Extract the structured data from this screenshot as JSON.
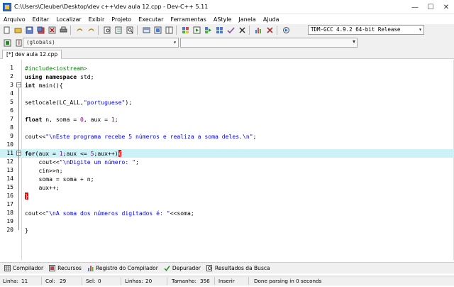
{
  "window": {
    "title": "C:\\Users\\Cleuber\\Desktop\\dev c++\\dev aula 12.cpp - Dev-C++ 5.11",
    "controls": {
      "minimize": "—",
      "maximize": "☐",
      "close": "✕"
    }
  },
  "menu": {
    "items": [
      {
        "label": "Arquivo"
      },
      {
        "label": "Editar"
      },
      {
        "label": "Localizar"
      },
      {
        "label": "Exibir"
      },
      {
        "label": "Projeto"
      },
      {
        "label": "Executar"
      },
      {
        "label": "Ferramentas"
      },
      {
        "label": "AStyle"
      },
      {
        "label": "Janela"
      },
      {
        "label": "Ajuda"
      }
    ]
  },
  "toolbar": {
    "compiler": "TDM-GCC 4.9.2 64-bit Release",
    "scope": "(globals)",
    "function": ""
  },
  "tabs": [
    {
      "label": "[*] dev aula 12.cpp"
    }
  ],
  "editor": {
    "current_line": 11,
    "lines": [
      {
        "n": "1",
        "text": "#include<iostream>"
      },
      {
        "n": "2",
        "text": "using namespace std;"
      },
      {
        "n": "3",
        "text": "int main(){"
      },
      {
        "n": "4",
        "text": ""
      },
      {
        "n": "5",
        "text": "setlocale(LC_ALL,\"portuguese\");"
      },
      {
        "n": "6",
        "text": ""
      },
      {
        "n": "7",
        "text": "float n, soma = 0, aux = 1;"
      },
      {
        "n": "8",
        "text": ""
      },
      {
        "n": "9",
        "text": "cout<<\"\\nEste programa recebe 5 números e realiza a soma deles.\\n\";"
      },
      {
        "n": "10",
        "text": ""
      },
      {
        "n": "11",
        "text": "for(aux = 1;aux <= 5;aux++){"
      },
      {
        "n": "12",
        "text": "    cout<<\"\\nDigite um número: \";"
      },
      {
        "n": "13",
        "text": "    cin>>n;"
      },
      {
        "n": "14",
        "text": "    soma = soma + n;"
      },
      {
        "n": "15",
        "text": "    aux++;"
      },
      {
        "n": "16",
        "text": "}"
      },
      {
        "n": "17",
        "text": ""
      },
      {
        "n": "18",
        "text": "cout<<\"\\nA soma dos números digitados é: \"<<soma;"
      },
      {
        "n": "19",
        "text": ""
      },
      {
        "n": "20",
        "text": "}"
      }
    ]
  },
  "bottom_tabs": [
    {
      "label": "Compilador",
      "icon": "grid-icon"
    },
    {
      "label": "Recursos",
      "icon": "resources-icon"
    },
    {
      "label": "Registro do Compilador",
      "icon": "chart-icon"
    },
    {
      "label": "Depurador",
      "icon": "check-icon"
    },
    {
      "label": "Resultados da Busca",
      "icon": "search-results-icon"
    }
  ],
  "status": {
    "line_label": "Linha:",
    "line_value": "11",
    "col_label": "Col:",
    "col_value": "29",
    "sel_label": "Sel:",
    "sel_value": "0",
    "lines_label": "Linhas:",
    "lines_value": "20",
    "size_label": "Tamanho:",
    "size_value": "356",
    "mode": "Inserir",
    "message": "Done parsing in 0 seconds"
  },
  "colors": {
    "current_line": "#ccf1f6",
    "brace_highlight": "#ff0000",
    "preprocessor": "#008000",
    "string": "#0000ff",
    "number": "#800080"
  }
}
